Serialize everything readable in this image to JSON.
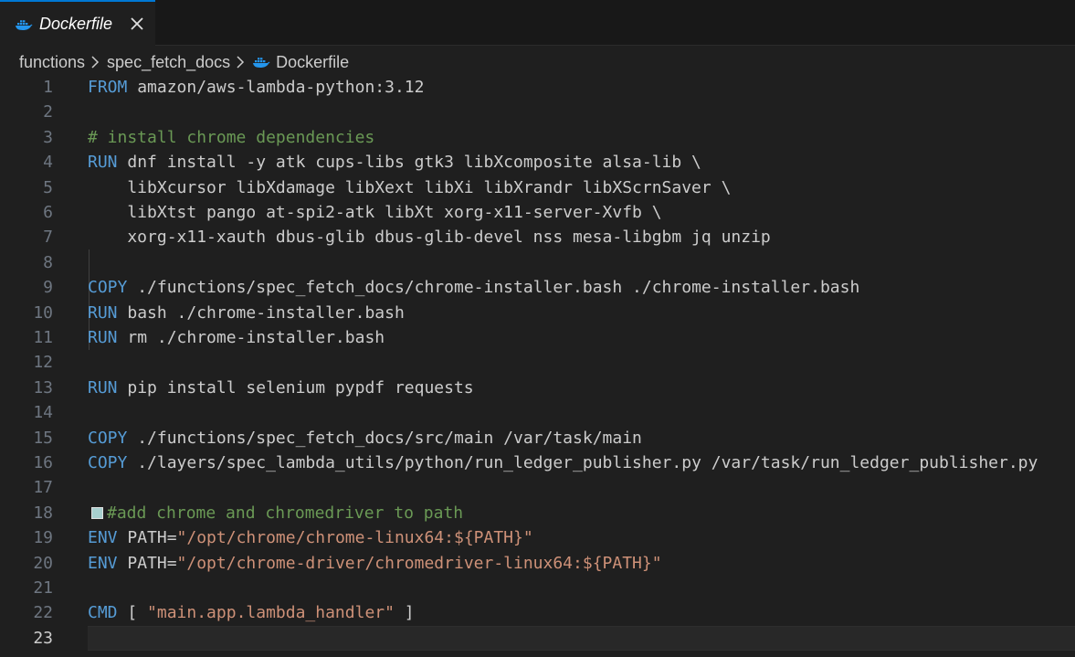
{
  "tab": {
    "label": "Dockerfile",
    "icon": "docker-whale-icon",
    "close_icon": "close-icon"
  },
  "breadcrumb": {
    "items": [
      "functions",
      "spec_fetch_docs"
    ],
    "file": "Dockerfile"
  },
  "colors": {
    "keyword": "#569cd6",
    "comment": "#6a9955",
    "string": "#ce9178",
    "text": "#cccccc",
    "line_number": "#6e7681",
    "background": "#1f1f1f",
    "docker_blue": "#2496ed"
  },
  "editor": {
    "current_line": 23,
    "lines": [
      {
        "n": "1",
        "tokens": [
          {
            "t": "FROM",
            "c": "kw"
          },
          {
            "t": " amazon/aws-lambda-python:3.12",
            "c": "tx"
          }
        ]
      },
      {
        "n": "2",
        "tokens": []
      },
      {
        "n": "3",
        "tokens": [
          {
            "t": "# install chrome dependencies",
            "c": "cm"
          }
        ]
      },
      {
        "n": "4",
        "tokens": [
          {
            "t": "RUN",
            "c": "kw"
          },
          {
            "t": " dnf install -y atk cups-libs gtk3 libXcomposite alsa-lib \\",
            "c": "tx"
          }
        ]
      },
      {
        "n": "5",
        "tokens": [
          {
            "t": "    libXcursor libXdamage libXext libXi libXrandr libXScrnSaver \\",
            "c": "tx"
          }
        ]
      },
      {
        "n": "6",
        "tokens": [
          {
            "t": "    libXtst pango at-spi2-atk libXt xorg-x11-server-Xvfb \\",
            "c": "tx"
          }
        ]
      },
      {
        "n": "7",
        "tokens": [
          {
            "t": "    xorg-x11-xauth dbus-glib dbus-glib-devel nss mesa-libgbm jq unzip",
            "c": "tx"
          }
        ]
      },
      {
        "n": "8",
        "tokens": []
      },
      {
        "n": "9",
        "tokens": [
          {
            "t": "COPY",
            "c": "kw"
          },
          {
            "t": " ./functions/spec_fetch_docs/chrome-installer.bash ./chrome-installer.bash",
            "c": "tx"
          }
        ]
      },
      {
        "n": "10",
        "tokens": [
          {
            "t": "RUN",
            "c": "kw"
          },
          {
            "t": " bash ./chrome-installer.bash",
            "c": "tx"
          }
        ]
      },
      {
        "n": "11",
        "tokens": [
          {
            "t": "RUN",
            "c": "kw"
          },
          {
            "t": " rm ./chrome-installer.bash",
            "c": "tx"
          }
        ]
      },
      {
        "n": "12",
        "tokens": []
      },
      {
        "n": "13",
        "tokens": [
          {
            "t": "RUN",
            "c": "kw"
          },
          {
            "t": " pip install selenium pypdf requests",
            "c": "tx"
          }
        ]
      },
      {
        "n": "14",
        "tokens": []
      },
      {
        "n": "15",
        "tokens": [
          {
            "t": "COPY",
            "c": "kw"
          },
          {
            "t": " ./functions/spec_fetch_docs/src/main /var/task/main",
            "c": "tx"
          }
        ]
      },
      {
        "n": "16",
        "tokens": [
          {
            "t": "COPY",
            "c": "kw"
          },
          {
            "t": " ./layers/spec_lambda_utils/python/run_ledger_publisher.py /var/task/run_ledger_publisher.py",
            "c": "tx"
          }
        ]
      },
      {
        "n": "17",
        "tokens": []
      },
      {
        "n": "18",
        "tokens": [
          {
            "t": "",
            "c": "swatch"
          },
          {
            "t": "#add chrome and chromedriver to path",
            "c": "cm"
          }
        ]
      },
      {
        "n": "19",
        "tokens": [
          {
            "t": "ENV",
            "c": "kw"
          },
          {
            "t": " PATH=",
            "c": "tx"
          },
          {
            "t": "\"/opt/chrome/chrome-linux64:${PATH}\"",
            "c": "str"
          }
        ]
      },
      {
        "n": "20",
        "tokens": [
          {
            "t": "ENV",
            "c": "kw"
          },
          {
            "t": " PATH=",
            "c": "tx"
          },
          {
            "t": "\"/opt/chrome-driver/chromedriver-linux64:${PATH}\"",
            "c": "str"
          }
        ]
      },
      {
        "n": "21",
        "tokens": []
      },
      {
        "n": "22",
        "tokens": [
          {
            "t": "CMD",
            "c": "kw"
          },
          {
            "t": " [ ",
            "c": "tx"
          },
          {
            "t": "\"main.app.lambda_handler\"",
            "c": "str"
          },
          {
            "t": " ]",
            "c": "tx"
          }
        ]
      },
      {
        "n": "23",
        "tokens": []
      }
    ]
  }
}
